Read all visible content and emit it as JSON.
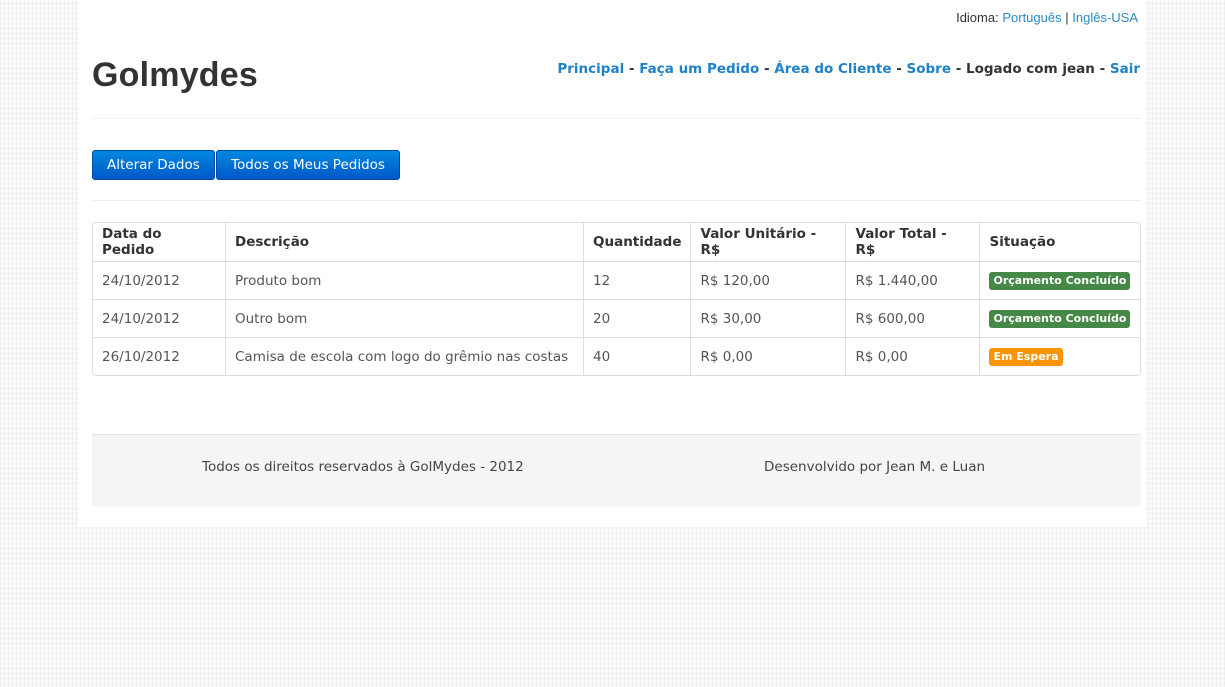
{
  "header": {
    "language_label": "Idioma:",
    "languages": [
      "Português",
      "Inglês-USA"
    ],
    "language_separator": "|",
    "brand": "Golmydes",
    "nav": {
      "principal": "Principal",
      "faca_pedido": "Faça um Pedido",
      "area_cliente": "Área do Cliente",
      "sobre": "Sobre",
      "logged_as": "Logado com jean",
      "sair": "Sair",
      "separator": "-"
    }
  },
  "actions": {
    "alterar_dados": "Alterar Dados",
    "todos_pedidos": "Todos os Meus Pedidos"
  },
  "orders": {
    "columns": [
      "Data do Pedido",
      "Descrição",
      "Quantidade",
      "Valor Unitário - R$",
      "Valor Total - R$",
      "Situação"
    ],
    "rows": [
      {
        "date": "24/10/2012",
        "desc": "Produto bom",
        "qty": "12",
        "unit": "R$ 120,00",
        "total": "R$ 1.440,00",
        "status": "Orçamento Concluído",
        "status_color": "#468847"
      },
      {
        "date": "24/10/2012",
        "desc": "Outro bom",
        "qty": "20",
        "unit": "R$ 30,00",
        "total": "R$ 600,00",
        "status": "Orçamento Concluído",
        "status_color": "#468847"
      },
      {
        "date": "26/10/2012",
        "desc": "Camisa de escola com logo do grêmio nas costas",
        "qty": "40",
        "unit": "R$ 0,00",
        "total": "R$ 0,00",
        "status": "Em Espera",
        "status_color": "#f89406"
      }
    ]
  },
  "footer": {
    "rights": "Todos os direitos reservados à GolMydes - 2012",
    "developed_by": "Desenvolvido por Jean M. e Luan"
  }
}
